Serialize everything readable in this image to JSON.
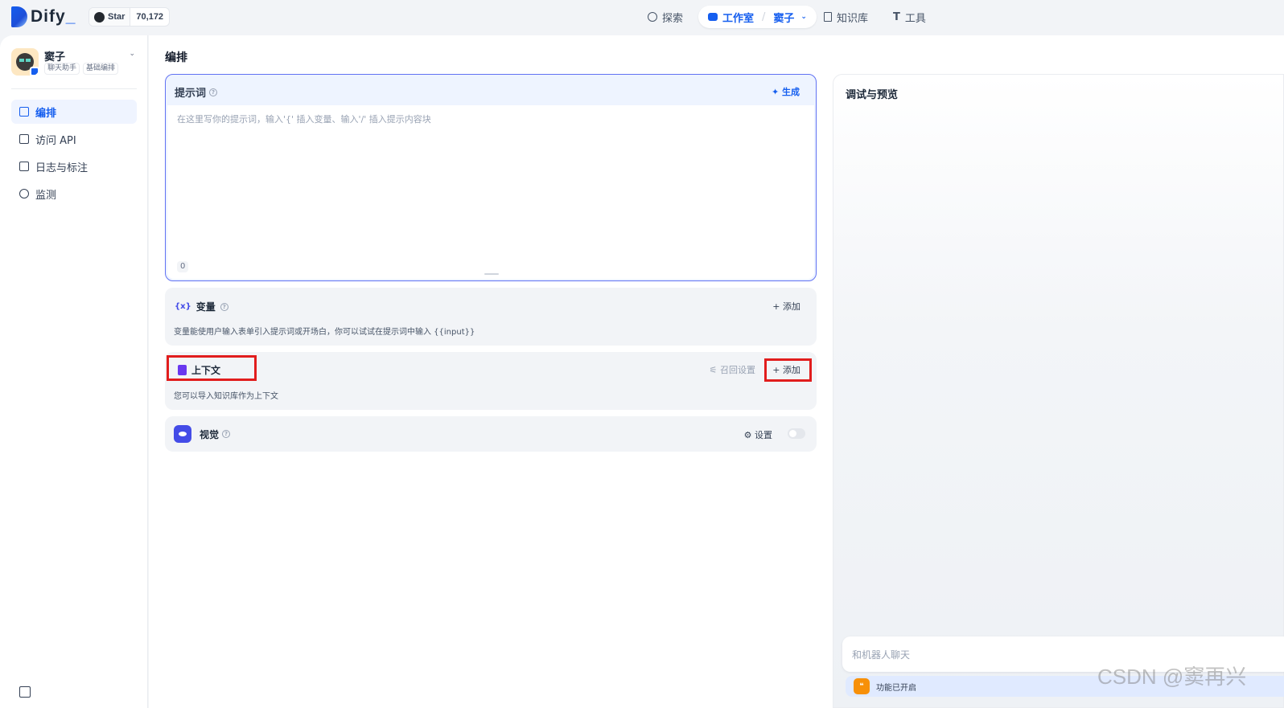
{
  "brand": {
    "name": "Dify",
    "underscore": "_"
  },
  "github": {
    "star_label": "Star",
    "star_count": "70,172"
  },
  "nav": {
    "explore": "探索",
    "studio": "工作室",
    "current_app": "窦子",
    "knowledge": "知识库",
    "tools": "工具"
  },
  "app": {
    "name": "窦子",
    "tags": [
      "聊天助手",
      "基础编排"
    ]
  },
  "sidebar": {
    "items": [
      {
        "label": "编排",
        "active": true
      },
      {
        "label": "访问 API",
        "active": false
      },
      {
        "label": "日志与标注",
        "active": false
      },
      {
        "label": "监测",
        "active": false
      }
    ]
  },
  "main": {
    "title": "编排"
  },
  "prompt": {
    "title": "提示词",
    "generate": "生成",
    "placeholder": "在这里写你的提示词，输入'{' 插入变量、输入'/' 插入提示内容块",
    "char_count": "0"
  },
  "variables": {
    "title": "变量",
    "add": "添加",
    "description": "变量能使用户输入表单引入提示词或开场白，你可以试试在提示词中输入 {{input}}"
  },
  "context": {
    "title": "上下文",
    "recall_settings": "召回设置",
    "add": "添加",
    "description": "您可以导入知识库作为上下文"
  },
  "vision": {
    "title": "视觉",
    "settings": "设置",
    "enabled": false
  },
  "debug": {
    "title": "调试与预览",
    "chat_placeholder": "和机器人聊天",
    "feature_status": "功能已开启"
  },
  "watermark": "CSDN @窦再兴",
  "colors": {
    "accent": "#155eef",
    "highlight": "#e11d1d",
    "context_icon": "#6938ef"
  }
}
